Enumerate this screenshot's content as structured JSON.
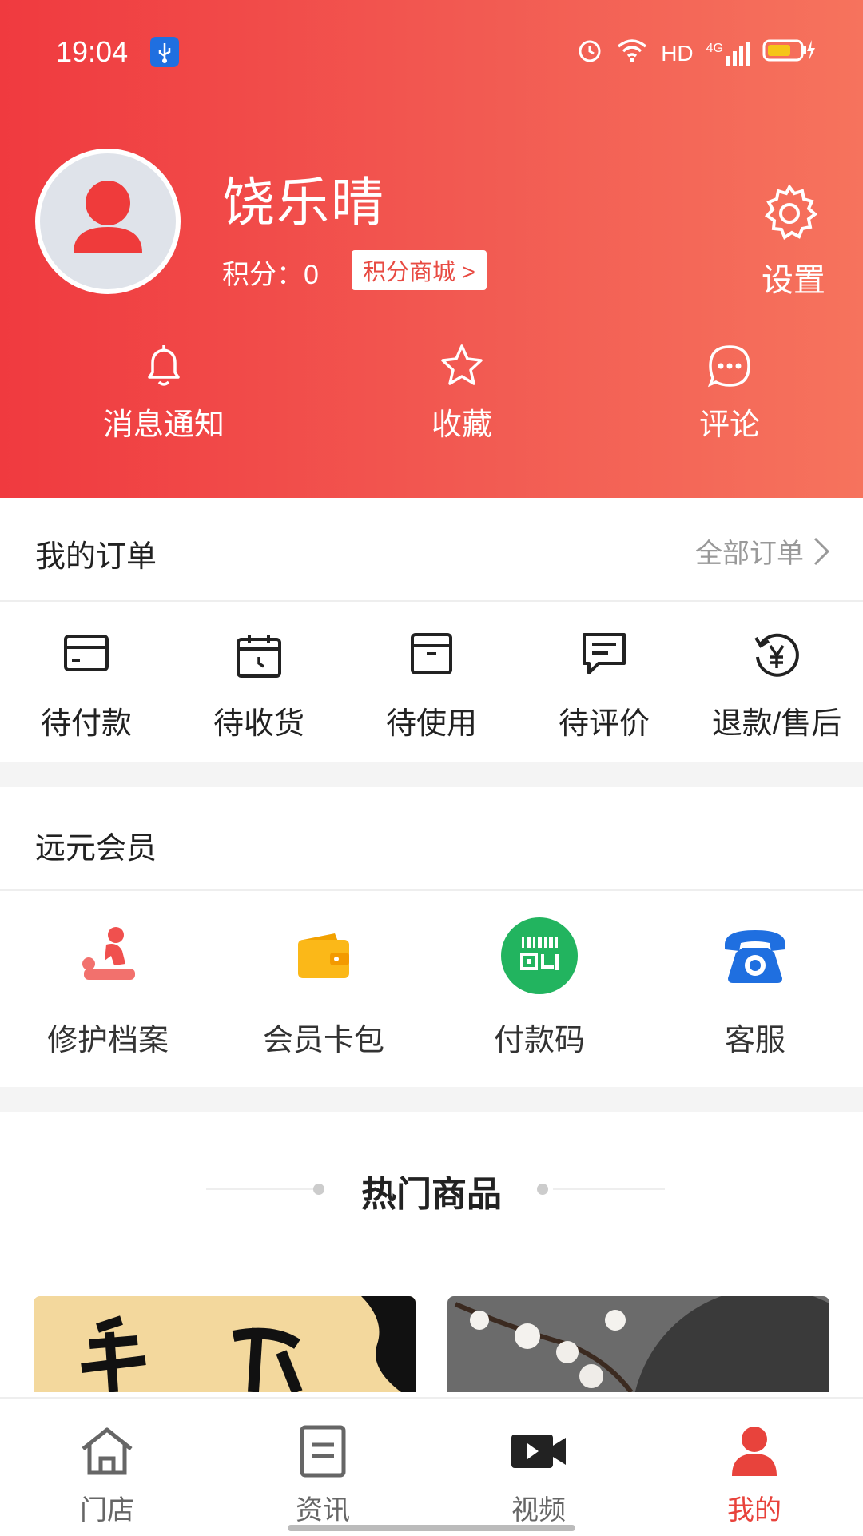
{
  "status_bar": {
    "time": "19:04",
    "network": "HD",
    "signal": "4G"
  },
  "profile": {
    "name": "饶乐晴",
    "points_text": "积分：0",
    "points_mall": "积分商城 >",
    "settings": "设置"
  },
  "quick_actions": [
    {
      "label": "消息通知",
      "icon": "bell-icon"
    },
    {
      "label": "收藏",
      "icon": "star-icon"
    },
    {
      "label": "评论",
      "icon": "comment-icon"
    }
  ],
  "orders": {
    "title": "我的订单",
    "all_link": "全部订单",
    "items": [
      {
        "label": "待付款",
        "icon": "card-icon"
      },
      {
        "label": "待收货",
        "icon": "calendar-clock-icon"
      },
      {
        "label": "待使用",
        "icon": "box-icon"
      },
      {
        "label": "待评价",
        "icon": "message-icon"
      },
      {
        "label": "退款/售后",
        "icon": "refund-yen-icon"
      }
    ]
  },
  "membership": {
    "title": "远元会员",
    "items": [
      {
        "label": "修护档案",
        "icon": "massage-icon"
      },
      {
        "label": "会员卡包",
        "icon": "wallet-icon"
      },
      {
        "label": "付款码",
        "icon": "qr-code-icon"
      },
      {
        "label": "客服",
        "icon": "phone-icon"
      }
    ]
  },
  "hot": {
    "title": "热门商品"
  },
  "tabbar": [
    {
      "label": "门店",
      "icon": "home-icon"
    },
    {
      "label": "资讯",
      "icon": "news-icon"
    },
    {
      "label": "视频",
      "icon": "video-icon"
    },
    {
      "label": "我的",
      "icon": "user-icon",
      "active": true
    }
  ],
  "colors": {
    "accent": "#e8433c",
    "header_start": "#f03a3f",
    "header_end": "#f6735d"
  }
}
